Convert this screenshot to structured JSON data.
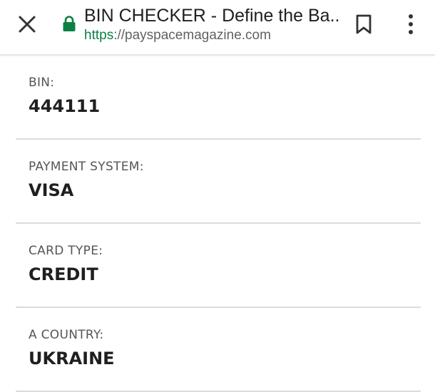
{
  "toolbar": {
    "title": "BIN CHECKER - Define the Ba...",
    "url_scheme": "https",
    "url_rest": "://payspacemagazine.com",
    "close_icon": "close-icon",
    "lock_icon": "lock-icon",
    "bookmark_icon": "bookmark-icon",
    "menu_icon": "more-vertical-icon",
    "lock_color": "#0b8043"
  },
  "details": [
    {
      "label": "BIN:",
      "value": "444111"
    },
    {
      "label": "PAYMENT SYSTEM:",
      "value": "VISA"
    },
    {
      "label": "CARD TYPE:",
      "value": "CREDIT"
    },
    {
      "label": "A COUNTRY:",
      "value": "UKRAINE"
    }
  ]
}
